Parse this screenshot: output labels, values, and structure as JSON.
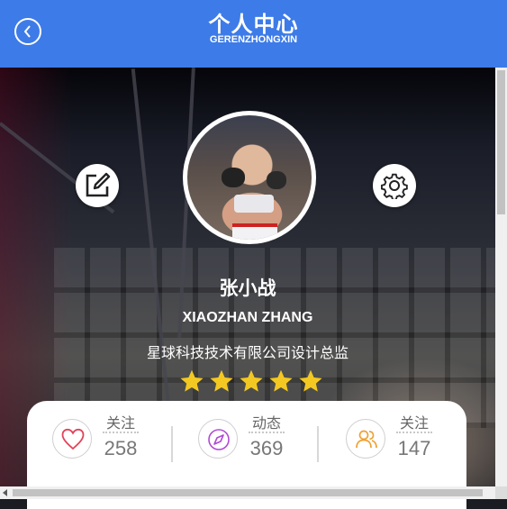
{
  "header": {
    "title": "个人中心",
    "subtitle": "GERENZHONGXIN",
    "back_icon": "chevron-left-icon",
    "color": "#3d7be8"
  },
  "profile": {
    "name": "张小战",
    "name_pinyin": "XIAOZHAN ZHANG",
    "position": "星球科技技术有限公司设计总监",
    "rating": 5,
    "rating_max": 5,
    "star_color": "#f3c822",
    "edit_icon": "edit-icon",
    "settings_icon": "gear-icon"
  },
  "stats": [
    {
      "label": "关注",
      "value": "258",
      "icon": "heart-icon",
      "icon_color": "#e0455a"
    },
    {
      "label": "动态",
      "value": "369",
      "icon": "compass-icon",
      "icon_color": "#b04ad6"
    },
    {
      "label": "关注",
      "value": "147",
      "icon": "users-icon",
      "icon_color": "#f0a030"
    }
  ]
}
